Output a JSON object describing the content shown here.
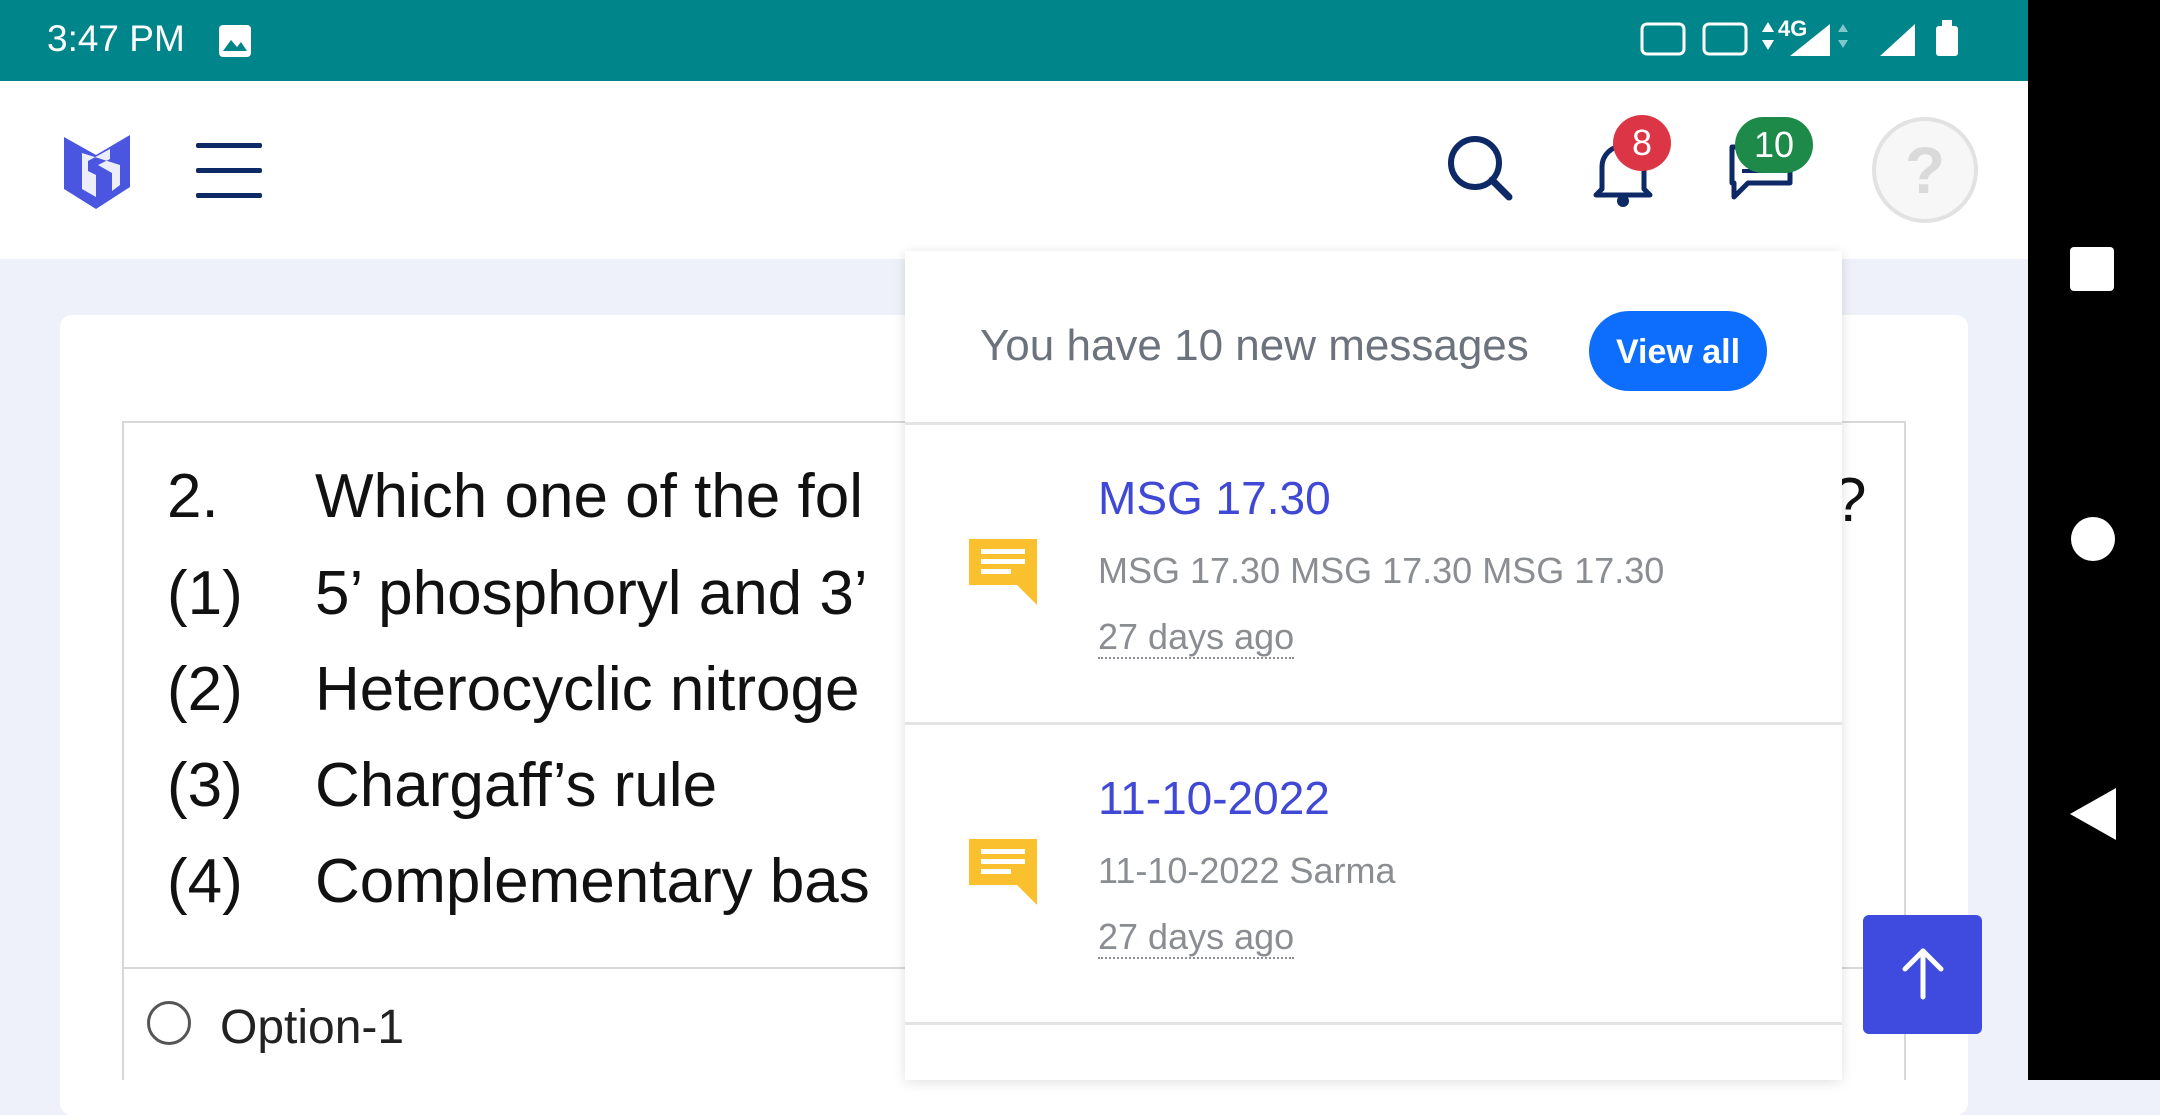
{
  "status_bar": {
    "time": "3:47 PM",
    "network_label": "4G"
  },
  "app_bar": {
    "notifications_count": "8",
    "messages_count": "10",
    "avatar_glyph": "?"
  },
  "question": {
    "lines": [
      {
        "num": "2.",
        "text": "Which one of the fol"
      },
      {
        "num": "(1)",
        "text": "5’ phosphoryl and 3’"
      },
      {
        "num": "(2)",
        "text": "Heterocyclic nitroge"
      },
      {
        "num": "(3)",
        "text": "Chargaff’s rule"
      },
      {
        "num": "(4)",
        "text": "Complementary bas"
      }
    ],
    "trailing_mark": "?",
    "option_1": "Option-1"
  },
  "messages_dropdown": {
    "header": "You have 10 new messages",
    "view_all": "View all",
    "items": [
      {
        "title": "MSG 17.30",
        "body": "MSG 17.30 MSG 17.30 MSG 17.30",
        "time": "27 days ago"
      },
      {
        "title": "11-10-2022",
        "body": "11-10-2022 Sarma",
        "time": "27 days ago"
      }
    ]
  },
  "colors": {
    "status_bar": "#00868a",
    "accent_blue": "#0d6efd",
    "badge_red": "#dc3545",
    "badge_green": "#1e8a4a",
    "message_icon": "#fbc02d"
  }
}
